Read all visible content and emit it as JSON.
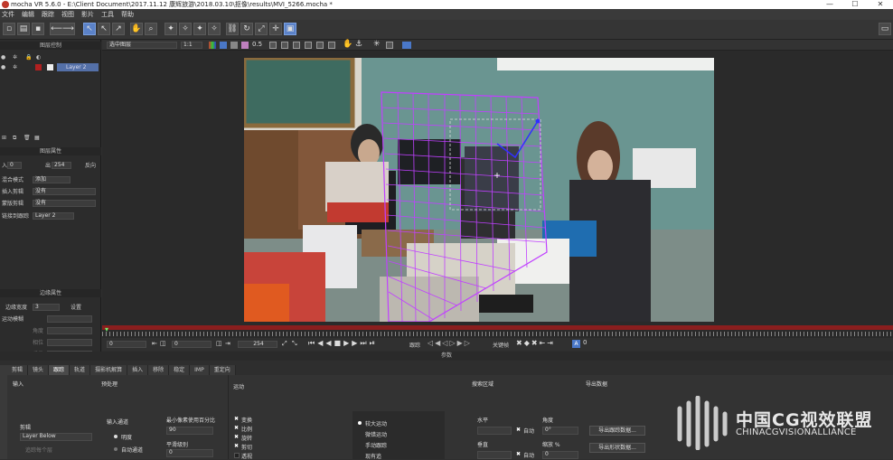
{
  "titlebar": {
    "title": "mocha VR 5.6.0 - E:\\Client Document\\2017.11.12 康辉旅游\\2018.03.10\\抠像\\results\\MVI_5266.mocha *",
    "min": "—",
    "max": "☐",
    "close": "✕"
  },
  "menu": [
    "文件",
    "编辑",
    "跟踪",
    "视图",
    "影片",
    "工具",
    "帮助"
  ],
  "left": {
    "layer_controls_title": "图层控制",
    "layer_name": "Layer 2",
    "layer_props_title": "图层属性",
    "in_label": "入",
    "in_value": "0",
    "out_label": "出",
    "out_value": "254",
    "reverse_label": "反向",
    "blend_label": "混合模式",
    "blend_value": "添加",
    "insert_clip_label": "插入剪辑",
    "insert_clip_value": "没有",
    "matte_clip_label": "蒙版剪辑",
    "matte_clip_value": "没有",
    "link_label": "链接到跟踪",
    "link_value": "Layer 2",
    "edge_title": "边缘属性",
    "edge_width_label": "边缘宽度",
    "edge_width_value": "3",
    "edge_set": "设置",
    "motion_blur_label": "运动模糊",
    "mb_a": "角度",
    "mb_b": "相位",
    "mb_c": "质量"
  },
  "viewer": {
    "view_select": "选中图层",
    "zoom": "1:1",
    "opacity": "0.5"
  },
  "transport": {
    "start": "0",
    "cur": "0",
    "end": "254",
    "track_label": "跟踪",
    "keyframe_label": "关键帧"
  },
  "params_title": "参数",
  "tabs": [
    "剪辑",
    "镜头",
    "跟踪",
    "轨道",
    "摄影机解算",
    "插入",
    "移除",
    "稳定",
    "IMP",
    "重定向"
  ],
  "active_tab": "跟踪",
  "bottom": {
    "input": "输入",
    "preprocess": "预处理",
    "motion": "运动",
    "search_area": "搜索区域",
    "export": "导出数据",
    "clip_label": "剪辑",
    "clip_value": "Layer Below",
    "track_individual": "追踪每个层",
    "input_channel": "输入通道",
    "ch_lum": "明度",
    "ch_auto": "自动通道",
    "min_pixels": "最小像素使用百分比",
    "min_pixels_value": "90",
    "smooth": "平滑级别",
    "smooth_value": "0",
    "m_translate": "变换",
    "m_scale": "比例",
    "m_rotate": "旋转",
    "m_shear": "剪切",
    "m_persp": "透视",
    "large_motion": "较大运动",
    "small_motion": "微错运动",
    "manual": "手动跟踪",
    "existing": "现有追",
    "horizontal": "水平",
    "vertical": "垂直",
    "auto1": "自动",
    "auto2": "自动",
    "angle": "角度",
    "angle_value": "0°",
    "zoom_label": "缩放 %",
    "zoom_value": "0",
    "export_track": "导出跟踪数据...",
    "export_shape": "导出形状数据..."
  },
  "watermark": {
    "cn": "中国CG视效联盟",
    "en": "CHINACGVISIONALLIANCE"
  }
}
